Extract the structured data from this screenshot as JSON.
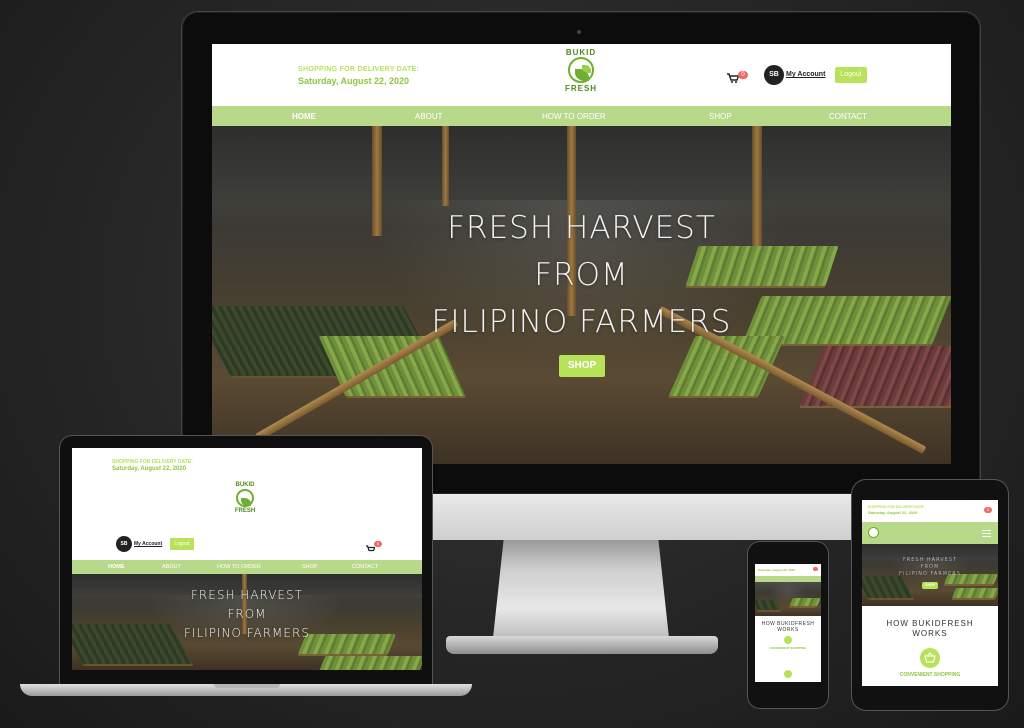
{
  "site": {
    "delivery_label": "SHOPPING FOR DELIVERY DATE:",
    "delivery_date": "Saturday, August 22, 2020",
    "logo_top": "BUKID",
    "logo_bottom": "FRESH",
    "cart_count": "0",
    "avatar_initials": "SB",
    "account_label": "My Account",
    "logout_label": "Logout",
    "nav": [
      "HOME",
      "ABOUT",
      "HOW TO ORDER",
      "SHOP",
      "CONTACT"
    ],
    "hero_line1": "FRESH HARVEST",
    "hero_line2": "FROM",
    "hero_line3": "FILIPINO FARMERS",
    "shop_button": "SHOP",
    "how_title_1": "HOW BUKIDFRESH",
    "how_title_2": "WORKS",
    "convenient": "CONVENIENT SHOPPING"
  },
  "colors": {
    "brand_green": "#b7e25a",
    "nav_green": "#b8d98a",
    "text_green": "#8cc63f",
    "cart_badge": "#f06a6a"
  },
  "icons": [
    "cart-icon",
    "logo-icon",
    "basket-icon",
    "hamburger-icon"
  ]
}
